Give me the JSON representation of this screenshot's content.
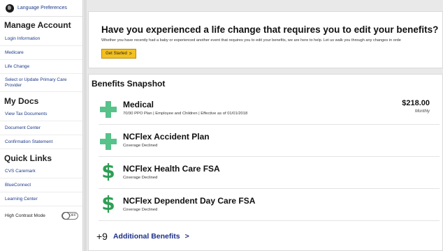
{
  "sidebar": {
    "language_label": "Language Preferences",
    "sections": [
      {
        "title": "Manage Account",
        "items": [
          "Login Information",
          "Medicare",
          "Life Change",
          "Select or Update Primary Care Provider"
        ]
      },
      {
        "title": "My Docs",
        "items": [
          "View Tax Documents",
          "Document Center",
          "Confirmation Statement"
        ]
      },
      {
        "title": "Quick Links",
        "items": [
          "CVS Caremark",
          "BlueConnect",
          "Learning Center"
        ]
      }
    ],
    "high_contrast": {
      "label": "High Contrast Mode",
      "state": "OFF"
    }
  },
  "banner": {
    "title": "Have you experienced a life change that requires you to edit your benefits?",
    "subtitle": "Whether you have recently had a baby or experienced another event that requires you to edit your benefits, we are here to help. Let us walk you through any changes in orde",
    "button_label": "Get Started",
    "button_chevron": ">"
  },
  "snapshot": {
    "title": "Benefits Snapshot",
    "benefits": [
      {
        "icon": "medical-cross-icon",
        "name": "Medical",
        "detail": "70/30 PPO Plan | Employee and Children | Effective as of 01/01/2018",
        "amount": "$218.00",
        "period": "Monthly"
      },
      {
        "icon": "medical-cross-icon",
        "name": "NCFlex Accident Plan",
        "detail": "Coverage Declined"
      },
      {
        "icon": "dollar-sign-icon",
        "name": "NCFlex Health Care FSA",
        "detail": "Coverage Declined"
      },
      {
        "icon": "dollar-sign-icon",
        "name": "NCFlex Dependent Day Care FSA",
        "detail": "Coverage Declined"
      }
    ],
    "additional": {
      "count": "+9",
      "label": "Additional Benefits",
      "chevron": ">"
    }
  },
  "colors": {
    "link": "#1d3a8a",
    "button": "#f4c01e",
    "cross": "#57c28a",
    "dollar": "#2f9e55"
  }
}
